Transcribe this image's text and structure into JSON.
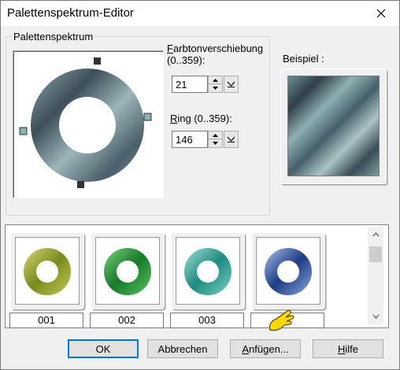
{
  "window": {
    "title": "Palettenspektrum-Editor",
    "close_icon": "close-icon"
  },
  "group": {
    "label": "Palettenspektrum"
  },
  "hue": {
    "label_line1": "Farbtonverschiebung",
    "label_line1_access": "F",
    "label_line1_rest": "arbtonverschiebung",
    "label_line2": "(0..359):",
    "value": "21"
  },
  "ring": {
    "label_access": "R",
    "label_rest": "ing (0..359):",
    "value": "146"
  },
  "example": {
    "label": "Beispiel :"
  },
  "palettes": [
    {
      "label": "001",
      "color": "#a8b032"
    },
    {
      "label": "002",
      "color": "#2e9c3c"
    },
    {
      "label": "003",
      "color": "#4aa8a0"
    },
    {
      "label": "",
      "color": "#3a5ca8"
    }
  ],
  "buttons": {
    "ok": "OK",
    "cancel": "Abbrechen",
    "append_access": "A",
    "append_rest": "nfügen...",
    "help_access": "H",
    "help_rest": "ilfe"
  },
  "colors": {
    "ring_dark": "#3d4c56",
    "ring_light": "#9db4b8",
    "accent": "#0078d7"
  }
}
